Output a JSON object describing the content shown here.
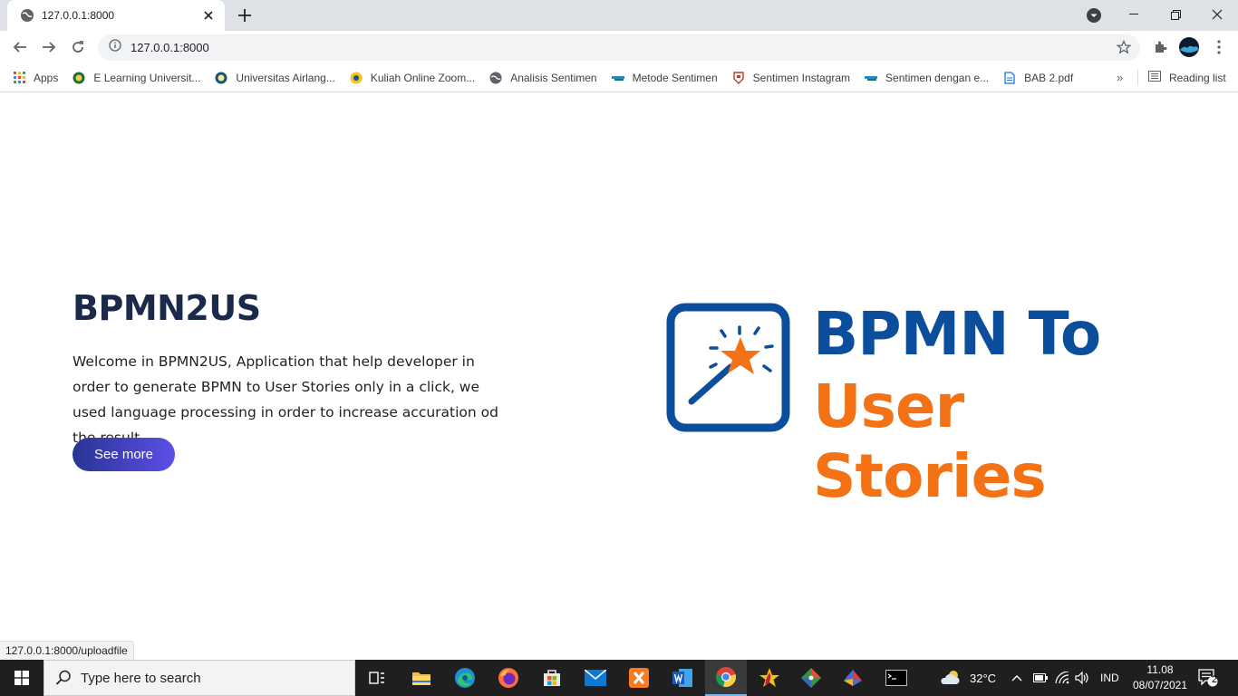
{
  "browser": {
    "tab": {
      "title": "127.0.0.1:8000"
    },
    "address": {
      "url": "127.0.0.1:8000"
    },
    "bookmarks": [
      {
        "label": "Apps",
        "icon": "apps-grid-icon"
      },
      {
        "label": "E Learning Universit...",
        "icon": "university-logo-icon"
      },
      {
        "label": "Universitas Airlang...",
        "icon": "university-logo-icon"
      },
      {
        "label": "Kuliah Online Zoom...",
        "icon": "university-logo-icon"
      },
      {
        "label": "Analisis Sentimen",
        "icon": "globe-icon"
      },
      {
        "label": "Metode Sentimen",
        "icon": "site-logo-icon"
      },
      {
        "label": "Sentimen Instagram",
        "icon": "site-logo-icon"
      },
      {
        "label": "Sentimen dengan e...",
        "icon": "site-logo-icon"
      },
      {
        "label": "BAB 2.pdf",
        "icon": "document-icon"
      }
    ],
    "more_label": "»",
    "reading_list": "Reading list",
    "status_url": "127.0.0.1:8000/uploadfile"
  },
  "page": {
    "title": "BPMN2US",
    "description": "Welcome in BPMN2US, Application that help developer in order to generate BPMN to User Stories only in a click, we used language processing in order to increase accuration od the result.",
    "button": "See more",
    "logo": {
      "line1": "BPMN To",
      "line2": "User Stories",
      "primary": "#0b4f9c",
      "accent": "#f47216"
    }
  },
  "taskbar": {
    "search_placeholder": "Type here to search",
    "weather": "32°C",
    "language": "IND",
    "time": "11.08",
    "date": "08/07/2021",
    "notifications": "2"
  }
}
